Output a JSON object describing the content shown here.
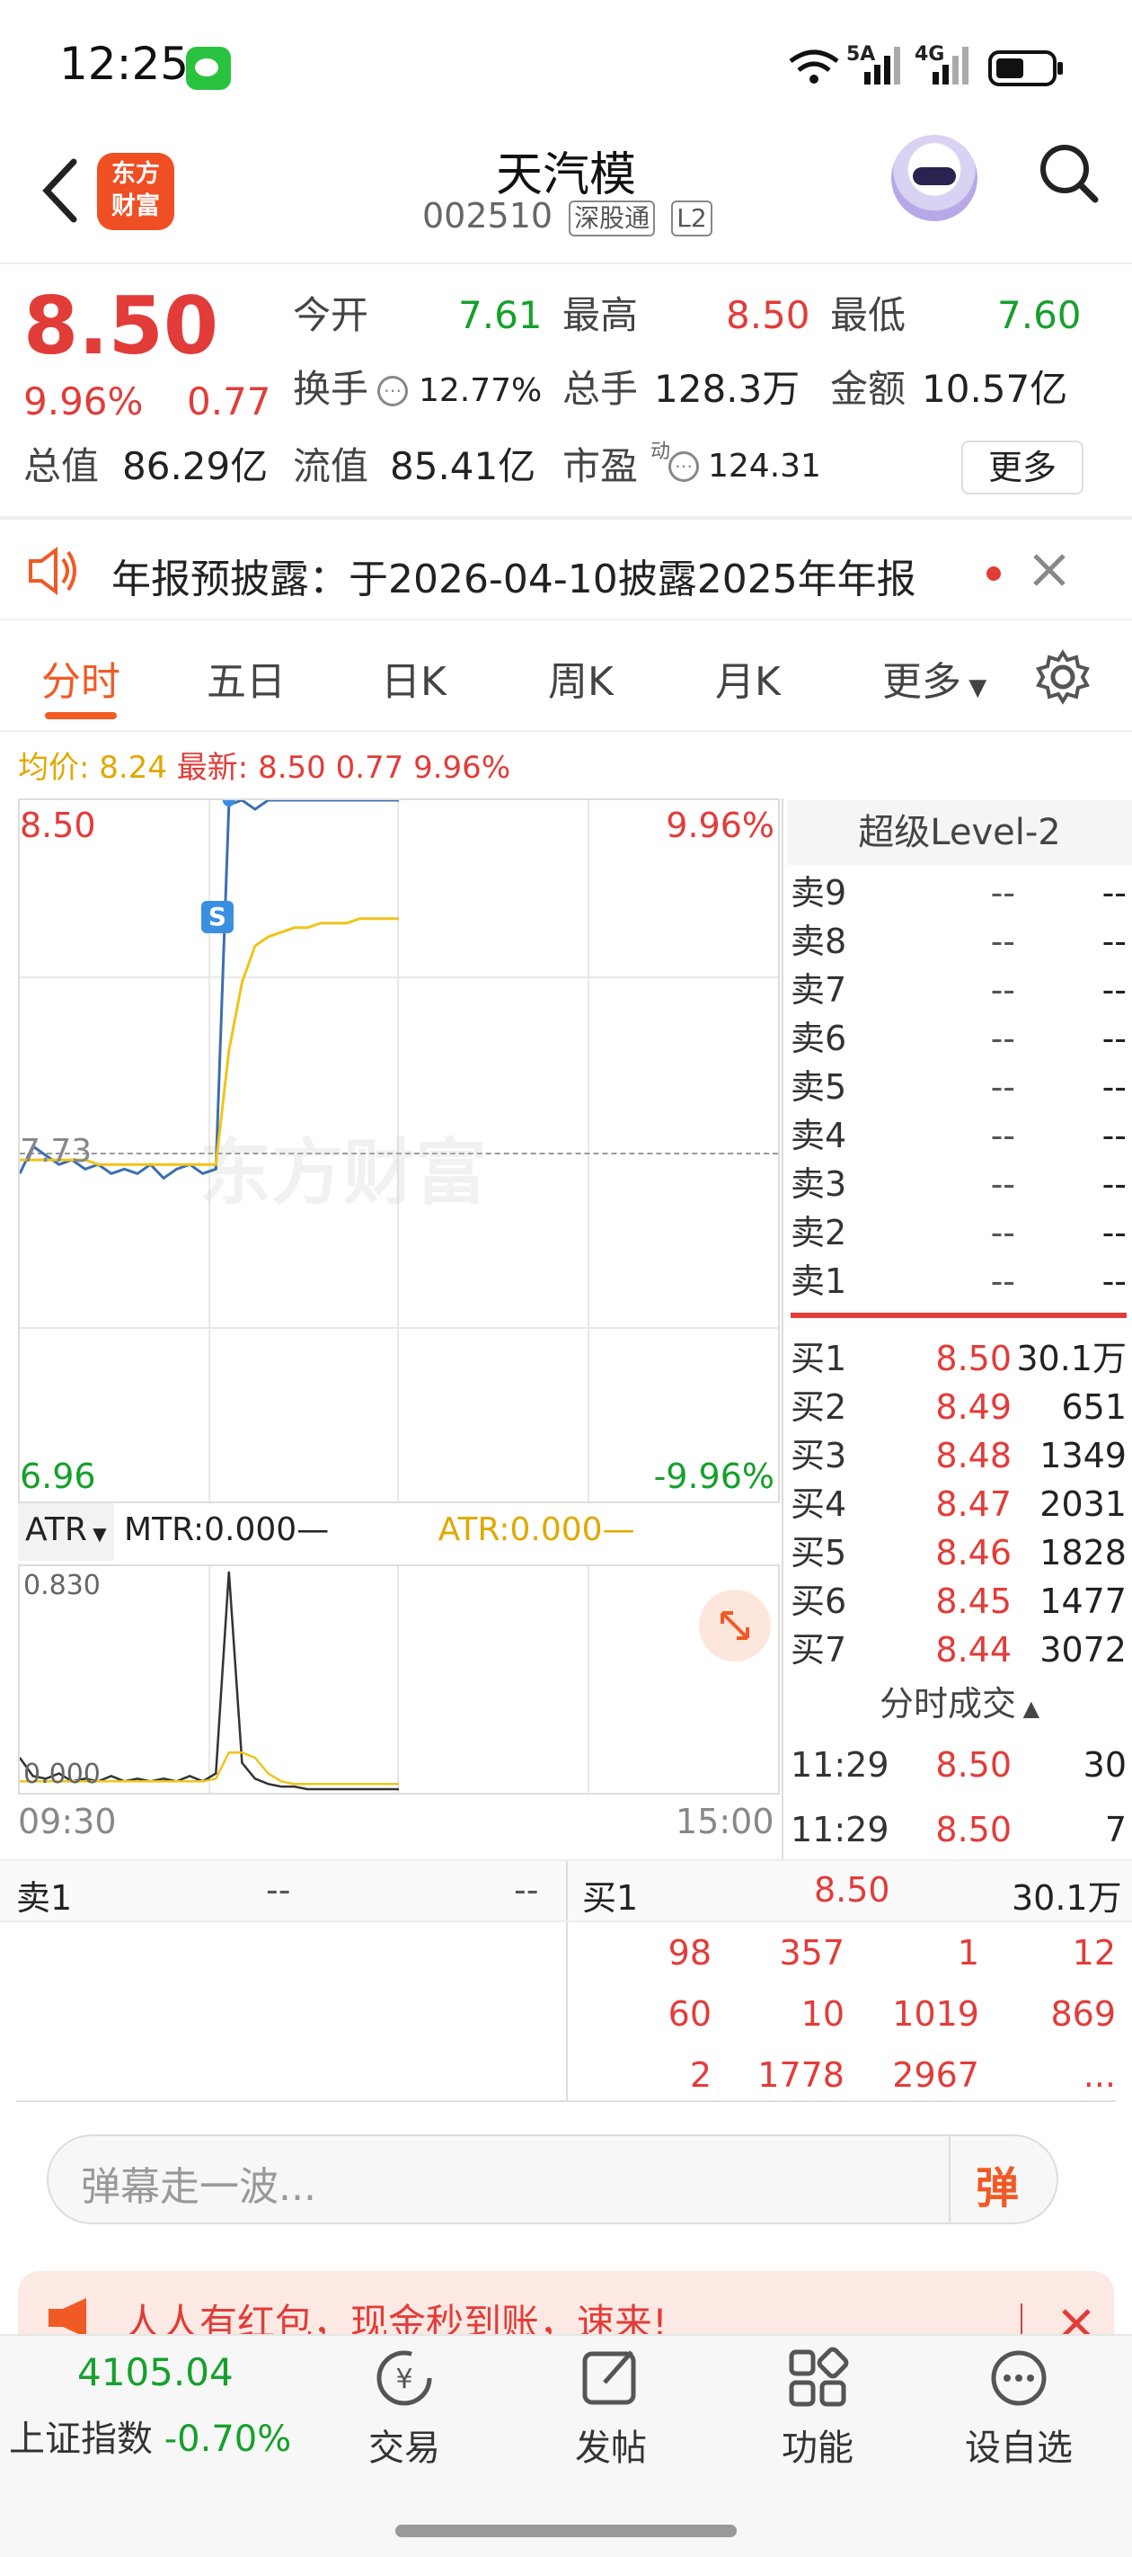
{
  "status_bar": {
    "time": "12:25",
    "net1": "5A",
    "net2": "4G"
  },
  "header": {
    "title": "天汽模",
    "code": "002510",
    "tag1": "深股通",
    "tag2": "L2",
    "logo": "东方\n财富",
    "logo_line1": "东方",
    "logo_line2": "财富"
  },
  "quote": {
    "price": "8.50",
    "pct": "9.96%",
    "change": "0.77",
    "open_label": "今开",
    "open": "7.61",
    "high_label": "最高",
    "high": "8.50",
    "low_label": "最低",
    "low": "7.60",
    "turnover_label": "换手",
    "turnover": "12.77%",
    "volume_label": "总手",
    "volume": "128.3万",
    "amount_label": "金额",
    "amount": "10.57亿",
    "mktcap_label": "总值",
    "mktcap": "86.29亿",
    "float_label": "流值",
    "float": "85.41亿",
    "pe_label": "市盈",
    "pe_sup": "动",
    "pe": "124.31",
    "more": "更多"
  },
  "notice": {
    "text": "年报预披露：于2026-04-10披露2025年年报"
  },
  "tabs": [
    "分时",
    "五日",
    "日K",
    "周K",
    "月K",
    "更多"
  ],
  "chart_info": {
    "avg_label": "均价:",
    "avg": "8.24",
    "latest_label": "最新:",
    "latest": "8.50",
    "chg": "0.77",
    "pct": "9.96%"
  },
  "chart_data": {
    "type": "line",
    "x_start": "09:30",
    "x_end": "15:00",
    "y_max": "8.50",
    "y_min": "6.96",
    "y_max_pct": "9.96%",
    "y_min_pct": "-9.96%",
    "ref": "7.73",
    "series": [
      {
        "name": "",
        "color": "#3a6fb0",
        "values": [
          7.68,
          7.74,
          7.72,
          7.7,
          7.71,
          7.69,
          7.7,
          7.68,
          7.69,
          7.68,
          7.7,
          7.67,
          7.69,
          7.7,
          7.68,
          7.69,
          8.49,
          8.5,
          8.48,
          8.5,
          8.5,
          8.5,
          8.5,
          8.5,
          8.5,
          8.5,
          8.5,
          8.5,
          8.5,
          8.5
        ]
      },
      {
        "name": "",
        "color": "#f0c419",
        "values": [
          7.71,
          7.71,
          7.71,
          7.71,
          7.71,
          7.71,
          7.7,
          7.7,
          7.7,
          7.7,
          7.7,
          7.7,
          7.7,
          7.7,
          7.7,
          7.7,
          7.95,
          8.1,
          8.18,
          8.2,
          8.21,
          8.22,
          8.22,
          8.23,
          8.23,
          8.23,
          8.24,
          8.24,
          8.24,
          8.24
        ]
      }
    ],
    "watermark": "东方财富"
  },
  "indicator": {
    "name": "ATR",
    "mtr": "MTR:0.000",
    "atr": "ATR:0.000",
    "top": "0.830",
    "bottom": "0.000"
  },
  "orderbook": {
    "title": "超级Level-2",
    "asks": [
      {
        "n": "卖9"
      },
      {
        "n": "卖8"
      },
      {
        "n": "卖7"
      },
      {
        "n": "卖6"
      },
      {
        "n": "卖5"
      },
      {
        "n": "卖4"
      },
      {
        "n": "卖3"
      },
      {
        "n": "卖2"
      },
      {
        "n": "卖1"
      }
    ],
    "empty": "--",
    "bids": [
      {
        "n": "买1",
        "p": "8.50",
        "v": "30.1万"
      },
      {
        "n": "买2",
        "p": "8.49",
        "v": "651"
      },
      {
        "n": "买3",
        "p": "8.48",
        "v": "1349"
      },
      {
        "n": "买4",
        "p": "8.47",
        "v": "2031"
      },
      {
        "n": "买5",
        "p": "8.46",
        "v": "1828"
      },
      {
        "n": "买6",
        "p": "8.45",
        "v": "1477"
      },
      {
        "n": "买7",
        "p": "8.44",
        "v": "3072"
      }
    ],
    "ticks_title": "分时成交",
    "ticks": [
      {
        "t": "11:29",
        "p": "8.50",
        "v": "30"
      },
      {
        "t": "11:29",
        "p": "8.50",
        "v": "7"
      }
    ]
  },
  "queue": {
    "sell_label": "卖1",
    "sell_p": "--",
    "sell_v": "--",
    "buy_label": "买1",
    "buy_p": "8.50",
    "buy_v": "30.1万",
    "rows": [
      [
        "98",
        "357",
        "1",
        "12"
      ],
      [
        "60",
        "10",
        "1019",
        "869"
      ],
      [
        "2",
        "1778",
        "2967",
        "..."
      ]
    ]
  },
  "danmu": {
    "placeholder": "弹幕走一波...",
    "btn": "弹"
  },
  "promo": {
    "text": "人人有红包，现金秒到账，速来!"
  },
  "bottom_nav": {
    "index_value": "4105.04",
    "index_name": "上证指数",
    "index_pct": "-0.70%",
    "items": [
      "交易",
      "发帖",
      "功能",
      "设自选"
    ]
  }
}
